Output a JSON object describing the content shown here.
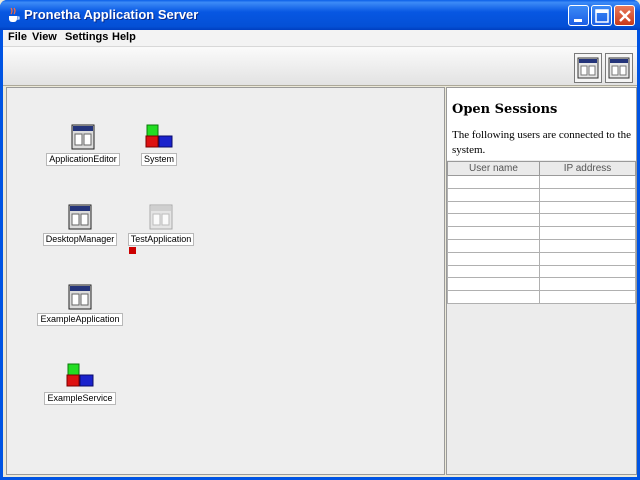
{
  "window": {
    "title": "Pronetha Application Server"
  },
  "menu": [
    "File",
    "View",
    "Settings",
    "Help"
  ],
  "desktop_icons": [
    {
      "label": "ApplicationEditor",
      "icon": "window-app-icon"
    },
    {
      "label": "System",
      "icon": "blocks-service-icon"
    },
    {
      "label": "DesktopManager",
      "icon": "window-app-icon"
    },
    {
      "label": "TestApplication",
      "icon": "window-app-icon-inactive",
      "status": "stopped"
    },
    {
      "label": "ExampleApplication",
      "icon": "window-app-icon"
    },
    {
      "label": "ExampleService",
      "icon": "blocks-service-icon"
    }
  ],
  "sessions": {
    "title": "Open Sessions",
    "description": "The following users are connected to the system.",
    "columns": [
      "User name",
      "IP address"
    ],
    "rows": []
  },
  "colors": {
    "title_bar": "#0054e3",
    "status_stopped": "#cc0000"
  }
}
